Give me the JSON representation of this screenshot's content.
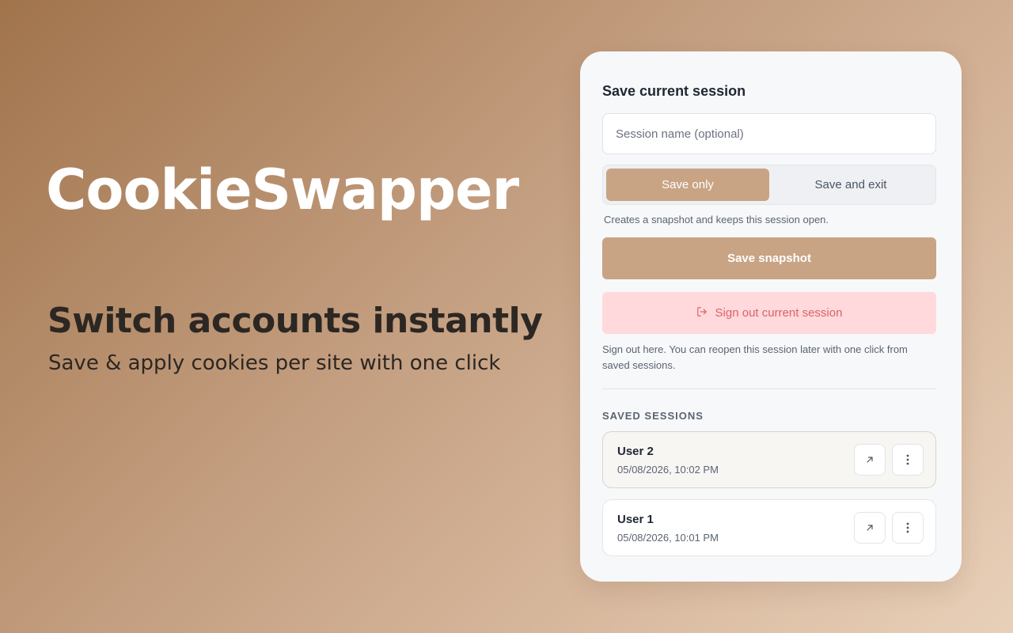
{
  "hero": {
    "brand": "CookieSwapper",
    "tagline": "Switch accounts instantly",
    "subtagline": "Save & apply cookies per site with one click"
  },
  "panel": {
    "title": "Save current session",
    "session_input": {
      "placeholder": "Session name (optional)",
      "value": ""
    },
    "mode_toggle": {
      "options": [
        "Save only",
        "Save and exit"
      ],
      "selected": "Save only"
    },
    "mode_hint": "Creates a snapshot and keeps this session open.",
    "save_button": "Save snapshot",
    "signout_button": "Sign out current session",
    "signout_hint": "Sign out here. You can reopen this session later with one click from saved sessions.",
    "saved_label": "SAVED SESSIONS",
    "sessions": [
      {
        "name": "User 2",
        "date": "05/08/2026, 10:02 PM"
      },
      {
        "name": "User 1",
        "date": "05/08/2026, 10:01 PM"
      }
    ]
  },
  "icons": {
    "signout": "sign-out-icon",
    "open": "arrow-up-right-icon",
    "menu": "more-vertical-icon"
  },
  "colors": {
    "accent": "#c8a484",
    "danger_bg": "#ffd9db",
    "danger_text": "#d9636a"
  }
}
